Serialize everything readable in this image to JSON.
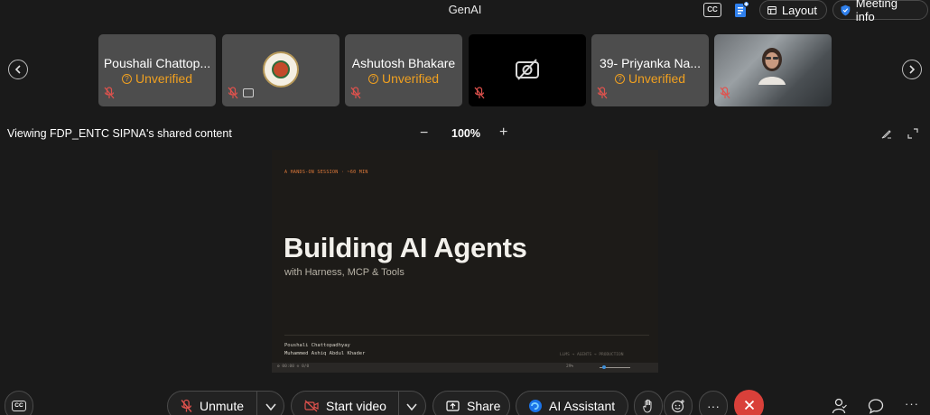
{
  "window": {
    "title": "GenAI"
  },
  "top_bar": {
    "cc_label": "CC",
    "layout_label": "Layout",
    "meeting_info_label": "Meeting info"
  },
  "participants": [
    {
      "name": "Poushali Chattop...",
      "status": "Unverified",
      "muted": true,
      "video": "off"
    },
    {
      "name": "",
      "status": "",
      "muted": true,
      "video": "logo",
      "sharing": true
    },
    {
      "name": "Ashutosh Bhakare",
      "status": "Unverified",
      "muted": true,
      "video": "off"
    },
    {
      "name": "",
      "status": "",
      "muted": true,
      "video": "camera-off"
    },
    {
      "name": "39- Priyanka Na...",
      "status": "Unverified",
      "muted": true,
      "video": "off"
    },
    {
      "name": "",
      "status": "",
      "muted": true,
      "video": "on"
    }
  ],
  "share": {
    "viewing_label": "Viewing FDP_ENTC SIPNA's shared content",
    "zoom": "100%",
    "zoom_minus": "−",
    "zoom_plus": "+"
  },
  "slide": {
    "kicker": "A HANDS-ON SESSION · ~60 MIN",
    "title": "Building AI Agents",
    "subtitle": "with Harness, MCP & Tools",
    "author1": "Poushali Chattopadhyay",
    "author2": "Muhammed Ashiq Abdul Khader",
    "footer_tag": "LLMS → AGENTS → PRODUCTION",
    "statusbar_left": "⚙ 00:00 ⊙ 0/0",
    "statusbar_zoom": "29%"
  },
  "controls": {
    "cc_label": "CC",
    "unmute_label": "Unmute",
    "start_video_label": "Start video",
    "share_label": "Share",
    "ai_assistant_label": "AI Assistant",
    "more_label": "···",
    "more_right_label": "···"
  },
  "colors": {
    "unverified": "#f0a020",
    "leave": "#d9403a",
    "ai_accent": "#1a73e8",
    "webex_accent": "#2f80ed"
  }
}
